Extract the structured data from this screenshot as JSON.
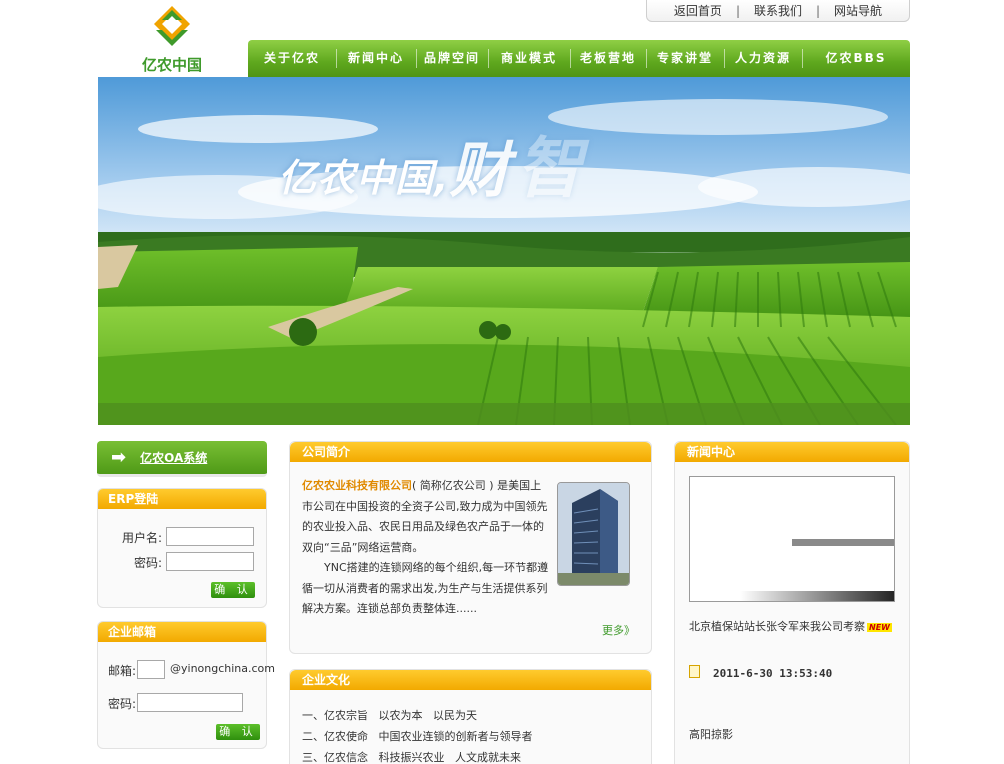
{
  "top_links": [
    "返回首页",
    "联系我们",
    "网站导航"
  ],
  "top_link_separator": "|",
  "logo": {
    "text": "亿农中国",
    "colors": {
      "green": "#3f9a2b",
      "orange": "#f0a300"
    }
  },
  "nav": [
    "关于亿农",
    "新闻中心",
    "品牌空间",
    "商业模式",
    "老板营地",
    "专家讲堂",
    "人力资源",
    "亿农BBS"
  ],
  "banner": {
    "text_main": "亿农中国,",
    "text_big": "财",
    "text_faint": "智"
  },
  "oa": {
    "label": "亿农OA系统",
    "arrow_icon": "➡"
  },
  "erp": {
    "title": "ERP登陆",
    "username_label": "用户名:",
    "password_label": "密码:",
    "submit": "确 认"
  },
  "mail": {
    "title": "企业邮箱",
    "email_label": "邮箱:",
    "domain": "@yinongchina.com",
    "password_label": "密码:",
    "submit": "确 认"
  },
  "intro": {
    "title": "公司简介",
    "brand": "亿农农业科技有限公司",
    "p1_rest": "( 简称亿农公司 ) 是美国上市公司在中国投资的全资子公司,致力成为中国领先的农业投入品、农民日用品及绿色农产品于一体的双向“三品”网络运营商。",
    "p2": "YNC搭建的连锁网络的每个组织,每一环节都遵循一切从消费者的需求出发,为生产与生活提供系列解决方案。连锁总部负责整体连......",
    "more": "更多》"
  },
  "culture": {
    "title": "企业文化",
    "lines": [
      "一、亿农宗旨   以农为本   以民为天",
      "二、亿农使命   中国农业连锁的创新者与领导者",
      "三、亿农信念   科技振兴农业   人文成就未来"
    ]
  },
  "news": {
    "title": "新闻中心",
    "headline": "北京植保站站长张令军来我公司考察",
    "new_badge": "NEW",
    "date": "2011-6-30 13:53:40",
    "caption": "高阳掠影"
  },
  "colors": {
    "green": "#5fa81e",
    "orange": "#f2a900"
  }
}
